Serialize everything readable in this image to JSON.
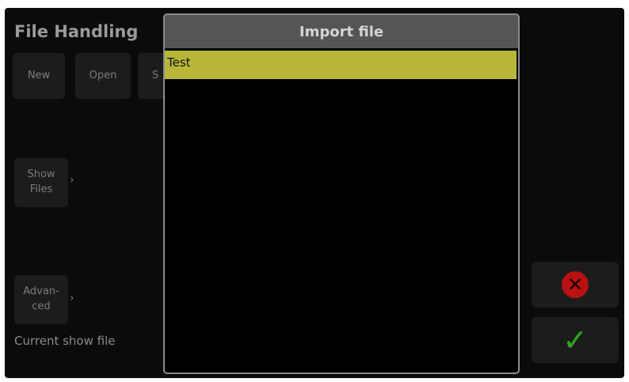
{
  "screen": {
    "title": "File Handling",
    "buttons": {
      "new": "New",
      "open": "Open",
      "save_partial": "S",
      "show_files_line1": "Show",
      "show_files_line2": "Files",
      "advanced_line1": "Advan-",
      "advanced_line2": "ced"
    },
    "arrow_glyph": "›",
    "current_show_file_label": "Current show file"
  },
  "dialog": {
    "title": "Import file",
    "files": [
      {
        "name": "Test",
        "selected": true
      }
    ]
  },
  "actions": {
    "cancel_icon": "cancel-icon",
    "confirm_icon": "checkmark-icon"
  },
  "colors": {
    "selection": "#b8b739",
    "cancel": "#b81212",
    "confirm": "#2fa81f",
    "header": "#555555"
  }
}
